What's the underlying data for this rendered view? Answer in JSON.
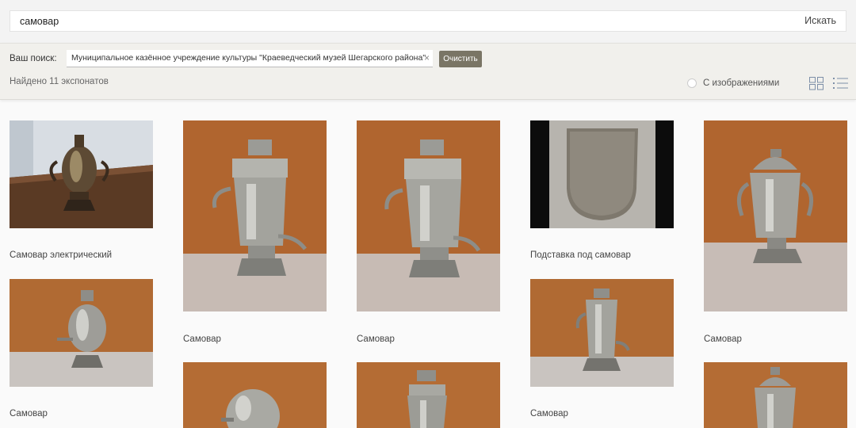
{
  "search": {
    "value": "самовар",
    "button_label": "Искать"
  },
  "filters": {
    "your_search_label": "Ваш поиск:",
    "chip_text": "Муниципальное казённое учреждение культуры \"Краеведческий музей Шегарского района\"",
    "chip_close": "×",
    "clear_label": "Очистить",
    "found_text": "Найдено 11 экспонатов",
    "with_images_label": "С изображениями"
  },
  "results": [
    {
      "caption": "Самовар электрический",
      "image": "electric-samovar-photo"
    },
    {
      "caption": "Самовар",
      "image": "samovar-photo"
    },
    {
      "caption": "Самовар",
      "image": "samovar-photo"
    },
    {
      "caption": "Подставка под самовар",
      "image": "tray-photo"
    },
    {
      "caption": "Самовар",
      "image": "samovar-photo"
    },
    {
      "caption": "Самовар",
      "image": "samovar-photo"
    },
    {
      "caption": "Самовар",
      "image": "samovar-photo"
    },
    {
      "caption": "",
      "image": "round-samovar-photo"
    },
    {
      "caption": "",
      "image": "samovar-photo"
    },
    {
      "caption": "",
      "image": "samovar-photo"
    }
  ],
  "colors": {
    "wood": "#b0652f",
    "table": "#c9bcb3",
    "silver": "#a9a9a3",
    "dark": "#231a14",
    "clear_btn": "#7a7565"
  }
}
